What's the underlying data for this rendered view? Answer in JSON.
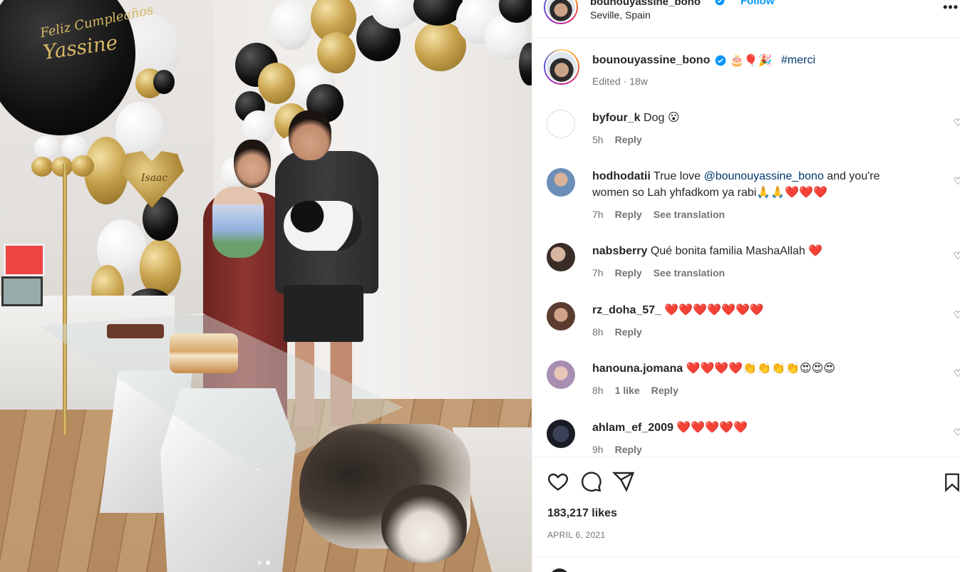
{
  "post": {
    "username": "bounouyassine_bono",
    "follow_label": "Follow",
    "location": "Seville, Spain",
    "more_label": "•••"
  },
  "photo": {
    "balloon_text_1": "Feliz Cumpleaños",
    "balloon_text_2": "Yassine",
    "heart_text": "Isaac",
    "carousel_dots": 2,
    "carousel_active": 2
  },
  "caption": {
    "username": "bounouyassine_bono",
    "emojis": "🎂🎈🎉",
    "hashtag": "#merci",
    "meta": "Edited · 18w"
  },
  "comments": [
    {
      "username": "byfour_k",
      "text": "Dog 😮",
      "time": "5h",
      "reply": "Reply"
    },
    {
      "username": "hodhodatii",
      "text_pre": "True love ",
      "mention": "@bounouyassine_bono",
      "text_post": " and you're women so Lah yhfadkom ya rabi🙏🙏❤️❤️❤️",
      "time": "7h",
      "reply": "Reply",
      "translate": "See translation"
    },
    {
      "username": "nabsberry",
      "text": "Qué bonita familia MashaAllah ❤️",
      "time": "7h",
      "reply": "Reply",
      "translate": "See translation"
    },
    {
      "username": "rz_doha_57_",
      "text": "❤️❤️❤️❤️❤️❤️❤️",
      "time": "8h",
      "reply": "Reply"
    },
    {
      "username": "hanouna.jomana",
      "text": "❤️❤️❤️❤️👏👏👏👏😍😍😍",
      "time": "8h",
      "likes": "1 like",
      "reply": "Reply"
    },
    {
      "username": "ahlam_ef_2009",
      "text": "❤️❤️❤️❤️❤️",
      "time": "9h",
      "reply": "Reply"
    }
  ],
  "engagement": {
    "likes": "183,217 likes",
    "date": "APRIL 6, 2021"
  },
  "colors": {
    "accent": "#0095f6",
    "mention": "#00376b",
    "muted": "#737373"
  }
}
